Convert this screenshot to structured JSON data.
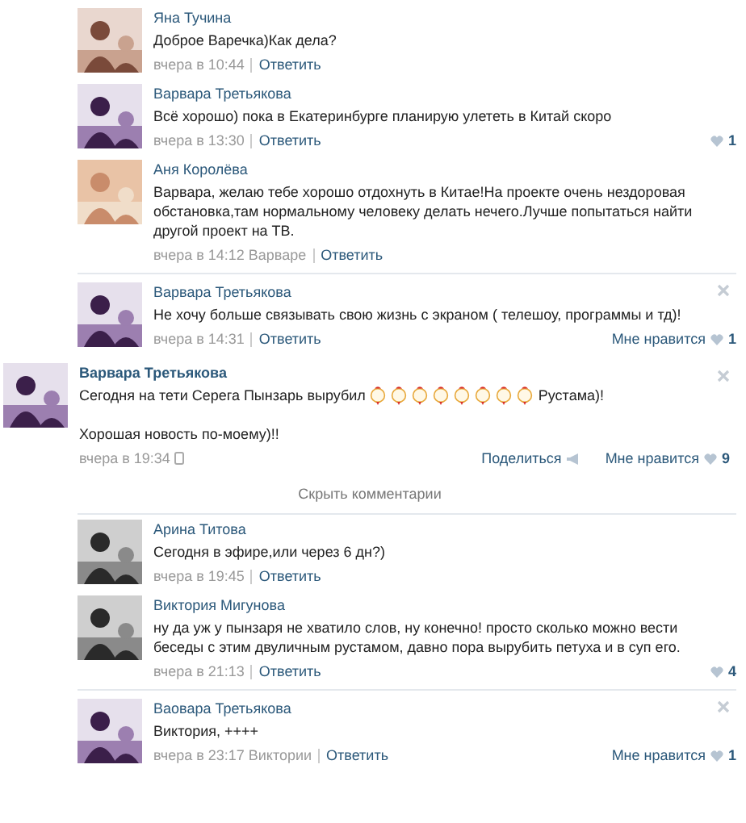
{
  "comments_top": [
    {
      "author": "Яна Тучина",
      "text": "Доброе Варечка)Как дела?",
      "time": "вчера в 10:44",
      "reply": "Ответить",
      "closable": false,
      "divider": false
    },
    {
      "author": "Варвара Третьякова",
      "text": "Всё хорошо) пока в Екатеринбурге планирую улететь в Китай скоро",
      "time": "вчера в 13:30",
      "reply": "Ответить",
      "like_count": "1",
      "closable": false,
      "divider": false
    },
    {
      "author": "Аня Королёва",
      "text": "Варвара, желаю тебе хорошо отдохнуть в Китае!На проекте очень нездоровая обстановка,там нормальному человеку делать нечего.Лучше попытаться найти другой проект на ТВ.",
      "time": "вчера в 14:12",
      "reply_to": "Варваре",
      "reply": "Ответить",
      "closable": false,
      "divider": true
    },
    {
      "author": "Варвара Третьякова",
      "text": "Не хочу больше связывать свою жизнь с экраном ( телешоу, программы и тд)!",
      "time": "вчера в 14:31",
      "reply": "Ответить",
      "like_label": "Мне нравится",
      "like_count": "1",
      "closable": true,
      "divider": false
    }
  ],
  "post": {
    "author": "Варвара Третьякова",
    "text_before": "Сегодня на тети Серега Пынзарь вырубил",
    "text_after": "Рустама)!",
    "text_2": "Хорошая новость по-моему)!!",
    "time": "вчера в 19:34",
    "share": "Поделиться",
    "like_label": "Мне нравится",
    "like_count": "9",
    "closable": true
  },
  "hide_comments": "Скрыть комментарии",
  "comments_bottom": [
    {
      "author": "Арина Титова",
      "text": "Сегодня в эфире,или через 6 дн?)",
      "time": "вчера в 19:45",
      "reply": "Ответить",
      "closable": false,
      "divider": false
    },
    {
      "author": "Виктория Мигунова",
      "text": "ну да уж у пынзаря не хватило слов, ну конечно! просто сколько можно вести беседы с этим двуличным рустамом, давно пора вырубить петуха и в суп его.",
      "time": "вчера в 21:13",
      "reply": "Ответить",
      "like_count": "4",
      "closable": false,
      "divider": true
    },
    {
      "author": "Ваовара Третьякова",
      "text": "Виктория, ++++",
      "time": "вчера в 23:17",
      "reply_to": "Виктории",
      "reply": "Ответить",
      "like_label": "Мне нравится",
      "like_count": "1",
      "closable": true,
      "divider": false
    }
  ]
}
